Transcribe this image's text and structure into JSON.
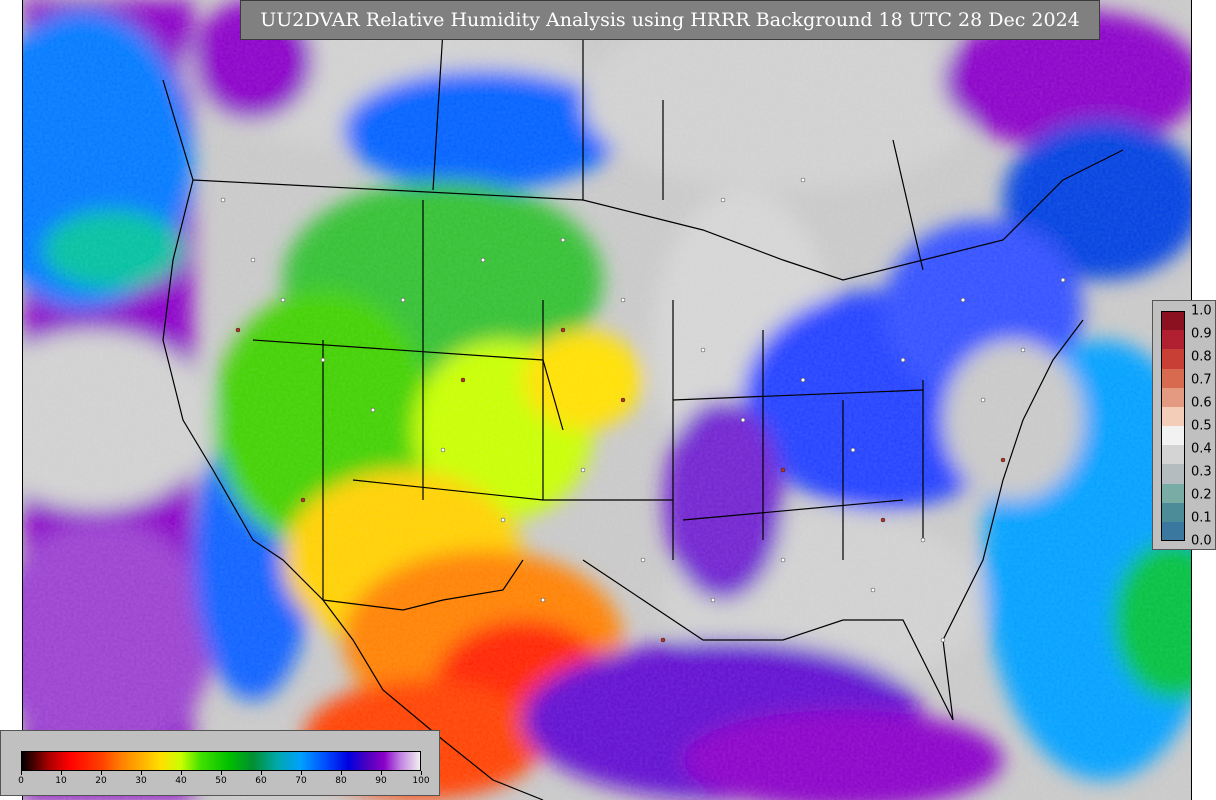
{
  "title": "UU2DVAR Relative Humidity Analysis using HRRR Background 18 UTC 28 Dec 2024",
  "horizontal_colorbar": {
    "ticks": [
      "0",
      "10",
      "20",
      "30",
      "40",
      "50",
      "60",
      "70",
      "80",
      "90",
      "100"
    ]
  },
  "vertical_colorbar": {
    "ticks": [
      "1.0",
      "0.9",
      "0.8",
      "0.7",
      "0.6",
      "0.5",
      "0.4",
      "0.3",
      "0.2",
      "0.1",
      "0.0"
    ],
    "colors": [
      "#8b1020",
      "#b02030",
      "#c84035",
      "#d86a50",
      "#e49a80",
      "#f3cdb8",
      "#f2f2f2",
      "#d4d4d4",
      "#b4bcc0",
      "#7aaca6",
      "#4c8c98",
      "#3a78a0",
      "#2a62a0",
      "#1e4c88",
      "#183a70",
      "#0e2a58",
      "#0a1e44",
      "#08183a",
      "#061430",
      "#041026",
      "#040d20",
      "#030a1a",
      "#020815"
    ]
  },
  "colors": {
    "ocean_moist": "#0050ff",
    "dry": "#ff2000",
    "mid": "#ffe000",
    "land_grey": "#c8c8c8",
    "very_moist": "#8a00c8"
  }
}
